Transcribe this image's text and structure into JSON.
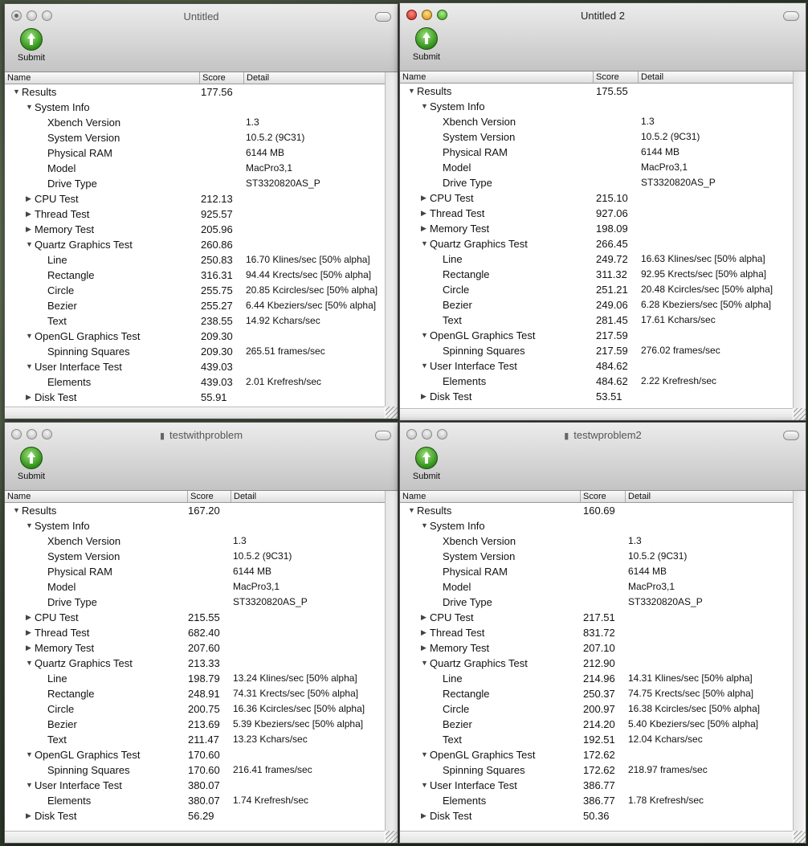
{
  "columns": {
    "name": "Name",
    "score": "Score",
    "detail": "Detail"
  },
  "submit_label": "Submit",
  "windows": [
    {
      "title": "Untitled",
      "rows": [
        {
          "label": "Results",
          "score": "177.56",
          "detail": "",
          "depth": 0,
          "disclosure": "open"
        },
        {
          "label": "System Info",
          "score": "",
          "detail": "",
          "depth": 1,
          "disclosure": "open"
        },
        {
          "label": "Xbench Version",
          "score": "",
          "detail": "1.3",
          "depth": 2,
          "disclosure": "none"
        },
        {
          "label": "System Version",
          "score": "",
          "detail": "10.5.2 (9C31)",
          "depth": 2,
          "disclosure": "none"
        },
        {
          "label": "Physical RAM",
          "score": "",
          "detail": "6144 MB",
          "depth": 2,
          "disclosure": "none"
        },
        {
          "label": "Model",
          "score": "",
          "detail": "MacPro3,1",
          "depth": 2,
          "disclosure": "none"
        },
        {
          "label": "Drive Type",
          "score": "",
          "detail": "ST3320820AS_P",
          "depth": 2,
          "disclosure": "none"
        },
        {
          "label": "CPU Test",
          "score": "212.13",
          "detail": "",
          "depth": 1,
          "disclosure": "closed"
        },
        {
          "label": "Thread Test",
          "score": "925.57",
          "detail": "",
          "depth": 1,
          "disclosure": "closed"
        },
        {
          "label": "Memory Test",
          "score": "205.96",
          "detail": "",
          "depth": 1,
          "disclosure": "closed"
        },
        {
          "label": "Quartz Graphics Test",
          "score": "260.86",
          "detail": "",
          "depth": 1,
          "disclosure": "open"
        },
        {
          "label": "Line",
          "score": "250.83",
          "detail": "16.70 Klines/sec [50% alpha]",
          "depth": 2,
          "disclosure": "none"
        },
        {
          "label": "Rectangle",
          "score": "316.31",
          "detail": "94.44 Krects/sec [50% alpha]",
          "depth": 2,
          "disclosure": "none"
        },
        {
          "label": "Circle",
          "score": "255.75",
          "detail": "20.85 Kcircles/sec [50% alpha]",
          "depth": 2,
          "disclosure": "none"
        },
        {
          "label": "Bezier",
          "score": "255.27",
          "detail": "6.44 Kbeziers/sec [50% alpha]",
          "depth": 2,
          "disclosure": "none"
        },
        {
          "label": "Text",
          "score": "238.55",
          "detail": "14.92 Kchars/sec",
          "depth": 2,
          "disclosure": "none"
        },
        {
          "label": "OpenGL Graphics Test",
          "score": "209.30",
          "detail": "",
          "depth": 1,
          "disclosure": "open"
        },
        {
          "label": "Spinning Squares",
          "score": "209.30",
          "detail": "265.51 frames/sec",
          "depth": 2,
          "disclosure": "none"
        },
        {
          "label": "User Interface Test",
          "score": "439.03",
          "detail": "",
          "depth": 1,
          "disclosure": "open"
        },
        {
          "label": "Elements",
          "score": "439.03",
          "detail": "2.01 Krefresh/sec",
          "depth": 2,
          "disclosure": "none"
        },
        {
          "label": "Disk Test",
          "score": "55.91",
          "detail": "",
          "depth": 1,
          "disclosure": "closed"
        }
      ]
    },
    {
      "title": "Untitled 2",
      "rows": [
        {
          "label": "Results",
          "score": "175.55",
          "detail": "",
          "depth": 0,
          "disclosure": "open"
        },
        {
          "label": "System Info",
          "score": "",
          "detail": "",
          "depth": 1,
          "disclosure": "open"
        },
        {
          "label": "Xbench Version",
          "score": "",
          "detail": "1.3",
          "depth": 2,
          "disclosure": "none"
        },
        {
          "label": "System Version",
          "score": "",
          "detail": "10.5.2 (9C31)",
          "depth": 2,
          "disclosure": "none"
        },
        {
          "label": "Physical RAM",
          "score": "",
          "detail": "6144 MB",
          "depth": 2,
          "disclosure": "none"
        },
        {
          "label": "Model",
          "score": "",
          "detail": "MacPro3,1",
          "depth": 2,
          "disclosure": "none"
        },
        {
          "label": "Drive Type",
          "score": "",
          "detail": "ST3320820AS_P",
          "depth": 2,
          "disclosure": "none"
        },
        {
          "label": "CPU Test",
          "score": "215.10",
          "detail": "",
          "depth": 1,
          "disclosure": "closed"
        },
        {
          "label": "Thread Test",
          "score": "927.06",
          "detail": "",
          "depth": 1,
          "disclosure": "closed"
        },
        {
          "label": "Memory Test",
          "score": "198.09",
          "detail": "",
          "depth": 1,
          "disclosure": "closed"
        },
        {
          "label": "Quartz Graphics Test",
          "score": "266.45",
          "detail": "",
          "depth": 1,
          "disclosure": "open"
        },
        {
          "label": "Line",
          "score": "249.72",
          "detail": "16.63 Klines/sec [50% alpha]",
          "depth": 2,
          "disclosure": "none"
        },
        {
          "label": "Rectangle",
          "score": "311.32",
          "detail": "92.95 Krects/sec [50% alpha]",
          "depth": 2,
          "disclosure": "none"
        },
        {
          "label": "Circle",
          "score": "251.21",
          "detail": "20.48 Kcircles/sec [50% alpha]",
          "depth": 2,
          "disclosure": "none"
        },
        {
          "label": "Bezier",
          "score": "249.06",
          "detail": "6.28 Kbeziers/sec [50% alpha]",
          "depth": 2,
          "disclosure": "none"
        },
        {
          "label": "Text",
          "score": "281.45",
          "detail": "17.61 Kchars/sec",
          "depth": 2,
          "disclosure": "none"
        },
        {
          "label": "OpenGL Graphics Test",
          "score": "217.59",
          "detail": "",
          "depth": 1,
          "disclosure": "open"
        },
        {
          "label": "Spinning Squares",
          "score": "217.59",
          "detail": "276.02 frames/sec",
          "depth": 2,
          "disclosure": "none"
        },
        {
          "label": "User Interface Test",
          "score": "484.62",
          "detail": "",
          "depth": 1,
          "disclosure": "open"
        },
        {
          "label": "Elements",
          "score": "484.62",
          "detail": "2.22 Krefresh/sec",
          "depth": 2,
          "disclosure": "none"
        },
        {
          "label": "Disk Test",
          "score": "53.51",
          "detail": "",
          "depth": 1,
          "disclosure": "closed"
        }
      ]
    },
    {
      "title": "testwithproblem",
      "rows": [
        {
          "label": "Results",
          "score": "167.20",
          "detail": "",
          "depth": 0,
          "disclosure": "open"
        },
        {
          "label": "System Info",
          "score": "",
          "detail": "",
          "depth": 1,
          "disclosure": "open"
        },
        {
          "label": "Xbench Version",
          "score": "",
          "detail": "1.3",
          "depth": 2,
          "disclosure": "none"
        },
        {
          "label": "System Version",
          "score": "",
          "detail": "10.5.2 (9C31)",
          "depth": 2,
          "disclosure": "none"
        },
        {
          "label": "Physical RAM",
          "score": "",
          "detail": "6144 MB",
          "depth": 2,
          "disclosure": "none"
        },
        {
          "label": "Model",
          "score": "",
          "detail": "MacPro3,1",
          "depth": 2,
          "disclosure": "none"
        },
        {
          "label": "Drive Type",
          "score": "",
          "detail": "ST3320820AS_P",
          "depth": 2,
          "disclosure": "none"
        },
        {
          "label": "CPU Test",
          "score": "215.55",
          "detail": "",
          "depth": 1,
          "disclosure": "closed"
        },
        {
          "label": "Thread Test",
          "score": "682.40",
          "detail": "",
          "depth": 1,
          "disclosure": "closed"
        },
        {
          "label": "Memory Test",
          "score": "207.60",
          "detail": "",
          "depth": 1,
          "disclosure": "closed"
        },
        {
          "label": "Quartz Graphics Test",
          "score": "213.33",
          "detail": "",
          "depth": 1,
          "disclosure": "open"
        },
        {
          "label": "Line",
          "score": "198.79",
          "detail": "13.24 Klines/sec [50% alpha]",
          "depth": 2,
          "disclosure": "none"
        },
        {
          "label": "Rectangle",
          "score": "248.91",
          "detail": "74.31 Krects/sec [50% alpha]",
          "depth": 2,
          "disclosure": "none"
        },
        {
          "label": "Circle",
          "score": "200.75",
          "detail": "16.36 Kcircles/sec [50% alpha]",
          "depth": 2,
          "disclosure": "none"
        },
        {
          "label": "Bezier",
          "score": "213.69",
          "detail": "5.39 Kbeziers/sec [50% alpha]",
          "depth": 2,
          "disclosure": "none"
        },
        {
          "label": "Text",
          "score": "211.47",
          "detail": "13.23 Kchars/sec",
          "depth": 2,
          "disclosure": "none"
        },
        {
          "label": "OpenGL Graphics Test",
          "score": "170.60",
          "detail": "",
          "depth": 1,
          "disclosure": "open"
        },
        {
          "label": "Spinning Squares",
          "score": "170.60",
          "detail": "216.41 frames/sec",
          "depth": 2,
          "disclosure": "none"
        },
        {
          "label": "User Interface Test",
          "score": "380.07",
          "detail": "",
          "depth": 1,
          "disclosure": "open"
        },
        {
          "label": "Elements",
          "score": "380.07",
          "detail": "1.74 Krefresh/sec",
          "depth": 2,
          "disclosure": "none"
        },
        {
          "label": "Disk Test",
          "score": "56.29",
          "detail": "",
          "depth": 1,
          "disclosure": "closed"
        }
      ]
    },
    {
      "title": "testwproblem2",
      "rows": [
        {
          "label": "Results",
          "score": "160.69",
          "detail": "",
          "depth": 0,
          "disclosure": "open"
        },
        {
          "label": "System Info",
          "score": "",
          "detail": "",
          "depth": 1,
          "disclosure": "open"
        },
        {
          "label": "Xbench Version",
          "score": "",
          "detail": "1.3",
          "depth": 2,
          "disclosure": "none"
        },
        {
          "label": "System Version",
          "score": "",
          "detail": "10.5.2 (9C31)",
          "depth": 2,
          "disclosure": "none"
        },
        {
          "label": "Physical RAM",
          "score": "",
          "detail": "6144 MB",
          "depth": 2,
          "disclosure": "none"
        },
        {
          "label": "Model",
          "score": "",
          "detail": "MacPro3,1",
          "depth": 2,
          "disclosure": "none"
        },
        {
          "label": "Drive Type",
          "score": "",
          "detail": "ST3320820AS_P",
          "depth": 2,
          "disclosure": "none"
        },
        {
          "label": "CPU Test",
          "score": "217.51",
          "detail": "",
          "depth": 1,
          "disclosure": "closed"
        },
        {
          "label": "Thread Test",
          "score": "831.72",
          "detail": "",
          "depth": 1,
          "disclosure": "closed"
        },
        {
          "label": "Memory Test",
          "score": "207.10",
          "detail": "",
          "depth": 1,
          "disclosure": "closed"
        },
        {
          "label": "Quartz Graphics Test",
          "score": "212.90",
          "detail": "",
          "depth": 1,
          "disclosure": "open"
        },
        {
          "label": "Line",
          "score": "214.96",
          "detail": "14.31 Klines/sec [50% alpha]",
          "depth": 2,
          "disclosure": "none"
        },
        {
          "label": "Rectangle",
          "score": "250.37",
          "detail": "74.75 Krects/sec [50% alpha]",
          "depth": 2,
          "disclosure": "none"
        },
        {
          "label": "Circle",
          "score": "200.97",
          "detail": "16.38 Kcircles/sec [50% alpha]",
          "depth": 2,
          "disclosure": "none"
        },
        {
          "label": "Bezier",
          "score": "214.20",
          "detail": "5.40 Kbeziers/sec [50% alpha]",
          "depth": 2,
          "disclosure": "none"
        },
        {
          "label": "Text",
          "score": "192.51",
          "detail": "12.04 Kchars/sec",
          "depth": 2,
          "disclosure": "none"
        },
        {
          "label": "OpenGL Graphics Test",
          "score": "172.62",
          "detail": "",
          "depth": 1,
          "disclosure": "open"
        },
        {
          "label": "Spinning Squares",
          "score": "172.62",
          "detail": "218.97 frames/sec",
          "depth": 2,
          "disclosure": "none"
        },
        {
          "label": "User Interface Test",
          "score": "386.77",
          "detail": "",
          "depth": 1,
          "disclosure": "open"
        },
        {
          "label": "Elements",
          "score": "386.77",
          "detail": "1.78 Krefresh/sec",
          "depth": 2,
          "disclosure": "none"
        },
        {
          "label": "Disk Test",
          "score": "50.36",
          "detail": "",
          "depth": 1,
          "disclosure": "closed"
        }
      ]
    }
  ]
}
